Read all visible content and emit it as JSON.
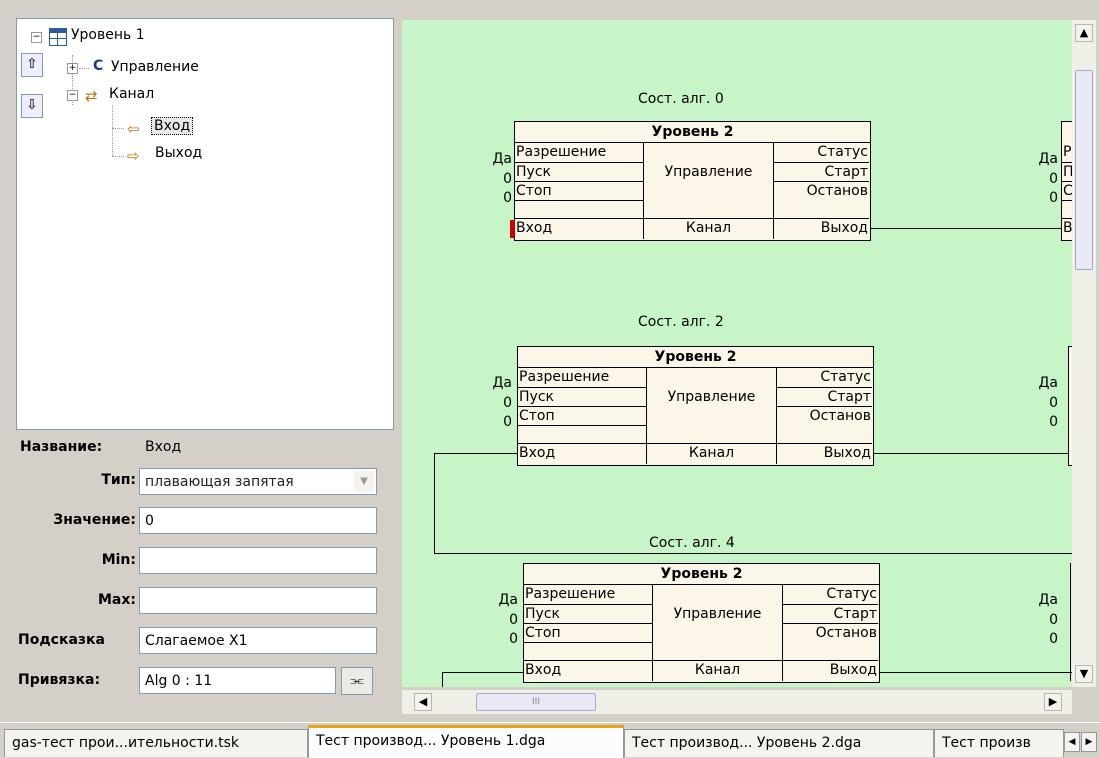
{
  "tree": {
    "root_label": "Уровень 1",
    "items": [
      {
        "prefix": "C",
        "label": "Управление"
      },
      {
        "label": "Канал"
      },
      {
        "label": "Вход"
      },
      {
        "label": "Выход"
      }
    ],
    "up_icon": "arrow-up-icon",
    "down_icon": "arrow-down-icon"
  },
  "props": {
    "name_label": "Название:",
    "name_value": "Вход",
    "type_label": "Тип:",
    "type_value": "плавающая запятая",
    "value_label": "Значение:",
    "value_value": "0",
    "min_label": "Min:",
    "min_value": "",
    "max_label": "Max:",
    "max_value": "",
    "hint_label": "Подсказка",
    "hint_value": "Слагаемое Х1",
    "binding_label": "Привязка:",
    "binding_value": "Alg 0 : 11",
    "binding_button_icon": "link-icon"
  },
  "blocks": [
    {
      "caption": "Сост. алг. 0",
      "title": "Уровень 2",
      "left_vals": [
        "Да",
        "0",
        "0"
      ],
      "inputs": [
        "Разрешение",
        "Пуск",
        "Стоп"
      ],
      "center": "Управление",
      "outputs": [
        "Статус",
        "Старт",
        "Останов"
      ],
      "bottom": [
        "Вход",
        "Канал",
        "Выход"
      ]
    },
    {
      "caption": "Сост. алг. 2",
      "title": "Уровень 2",
      "left_vals": [
        "Да",
        "0",
        "0"
      ],
      "inputs": [
        "Разрешение",
        "Пуск",
        "Стоп"
      ],
      "center": "Управление",
      "outputs": [
        "Статус",
        "Старт",
        "Останов"
      ],
      "bottom": [
        "Вход",
        "Канал",
        "Выход"
      ]
    },
    {
      "caption": "Сост. алг. 4",
      "title": "Уровень 2",
      "left_vals": [
        "Да",
        "0",
        "0"
      ],
      "inputs": [
        "Разрешение",
        "Пуск",
        "Стоп"
      ],
      "center": "Управление",
      "outputs": [
        "Статус",
        "Старт",
        "Останов"
      ],
      "bottom": [
        "Вход",
        "Канал",
        "Выход"
      ]
    }
  ],
  "right_partial": {
    "row0": {
      "vals": [
        "Да",
        "0",
        "0"
      ],
      "letters": [
        "Р",
        "П",
        "С",
        "В"
      ]
    },
    "row1": {
      "vals": [
        "Да",
        "0",
        "0"
      ]
    },
    "row2": {
      "vals": [
        "Да",
        "0",
        "0"
      ]
    }
  },
  "scroll": {
    "h_thumb_grip": "III"
  },
  "tabs": [
    {
      "label": "gas-тест прои...ительности.tsk",
      "active": false
    },
    {
      "label": "Тест производ... Уровень 1.dga",
      "active": true
    },
    {
      "label": "Тест производ... Уровень 2.dga",
      "active": false
    },
    {
      "label": "Тест произв",
      "active": false
    }
  ],
  "colors": {
    "canvas_bg": "#c8f5c8",
    "block_bg": "#fbf6e8",
    "active_tab_accent": "#e8a31a",
    "marker": "#cc0000"
  }
}
